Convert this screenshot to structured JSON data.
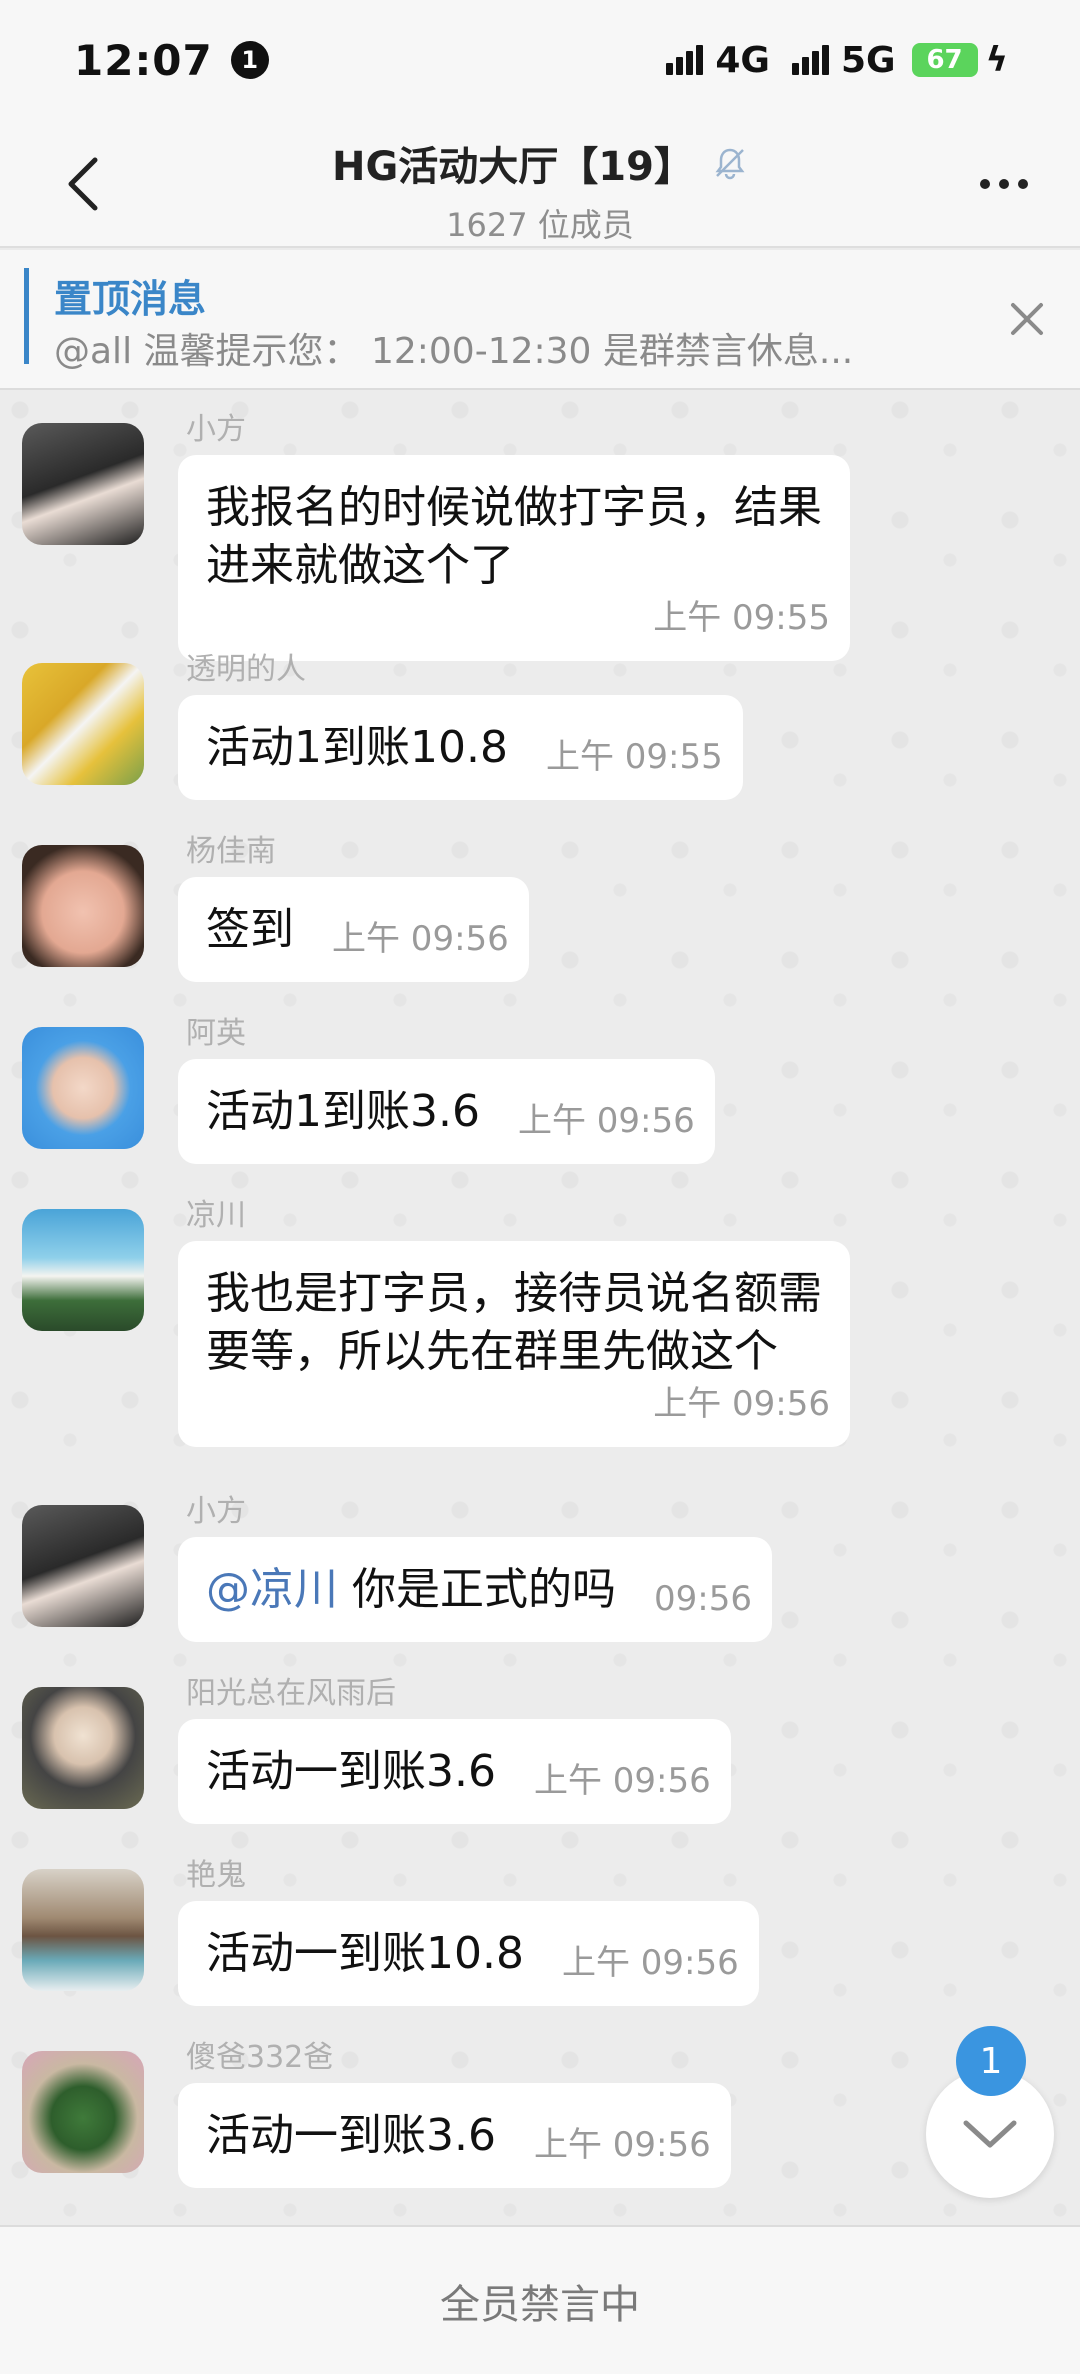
{
  "status_bar": {
    "time": "12:07",
    "notification_count": "1",
    "net1": "4G",
    "net2": "5G",
    "battery": "67"
  },
  "header": {
    "title": "HG活动大厅【19】",
    "subtitle": "1627 位成员"
  },
  "pinned": {
    "title": "置顶消息",
    "text": "@all 温馨提示您： 12:00-12:30 是群禁言休息..."
  },
  "messages": [
    {
      "sender": "小方",
      "text": "我报名的时候说做打字员，结果进来就做这个了",
      "time": "上午 09:55"
    },
    {
      "sender": "透明的人",
      "text": "活动1到账10.8",
      "time": "上午 09:55"
    },
    {
      "sender": "杨佳南",
      "text": "签到",
      "time": "上午 09:56"
    },
    {
      "sender": "阿英",
      "text": "活动1到账3.6",
      "time": "上午 09:56"
    },
    {
      "sender": "凉川",
      "text": "我也是打字员，接待员说名额需要等，所以先在群里先做这个",
      "time": "上午 09:56"
    },
    {
      "sender": "小方",
      "mention": "@凉川",
      "text": " 你是正式的吗",
      "time": "09:56"
    },
    {
      "sender": "阳光总在风雨后",
      "text": "活动一到账3.6",
      "time": "上午 09:56"
    },
    {
      "sender": "艳鬼",
      "text": "活动一到账10.8",
      "time": "上午 09:56"
    },
    {
      "sender": "傻爸332爸",
      "text": "活动一到账3.6",
      "time": "上午 09:56"
    }
  ],
  "unread_count": "1",
  "bottom_bar": {
    "label": "全员禁言中"
  }
}
